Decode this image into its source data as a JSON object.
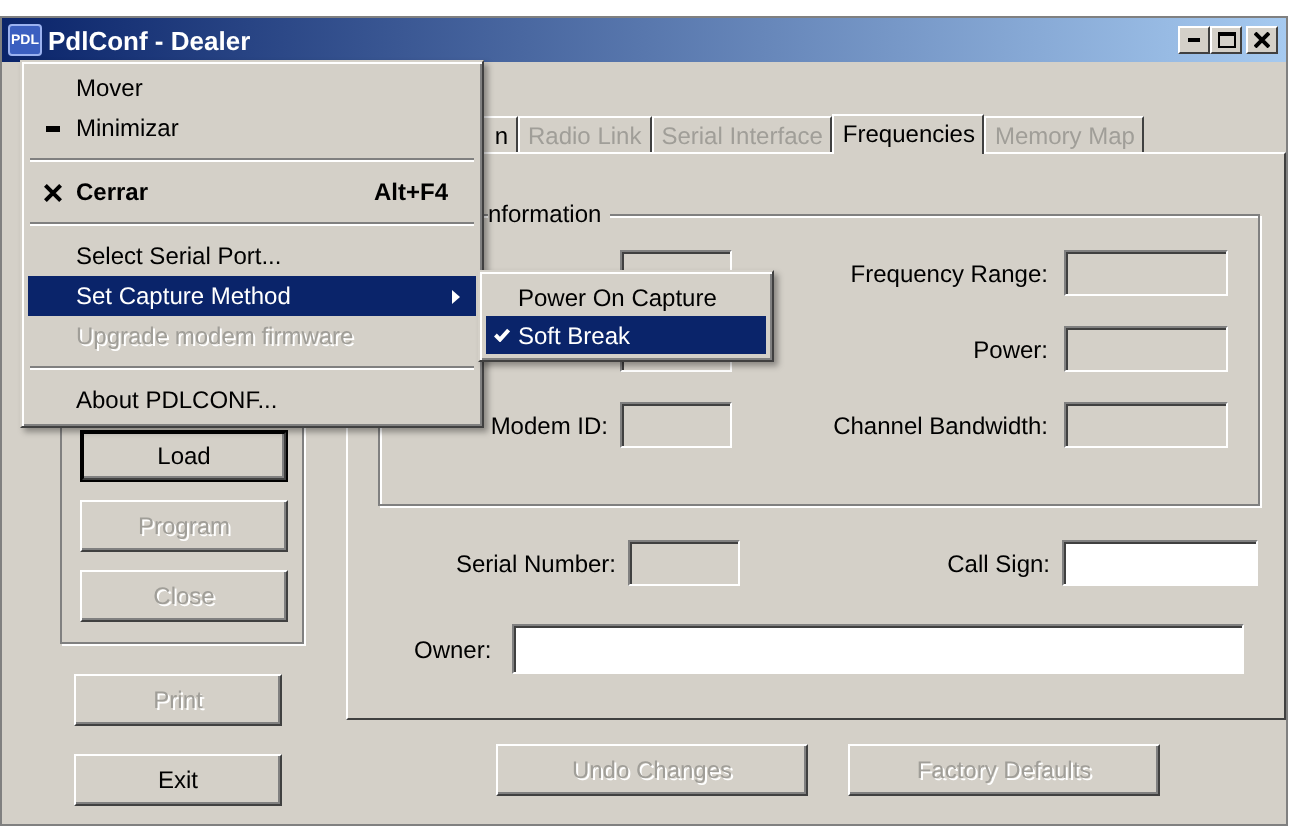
{
  "window": {
    "icon_text": "PDL",
    "title": "PdlConf - Dealer"
  },
  "left_group": {
    "buttons": [
      {
        "label": "Load",
        "disabled": false,
        "default": true
      },
      {
        "label": "Program",
        "disabled": true,
        "default": false
      },
      {
        "label": "Close",
        "disabled": true,
        "default": false
      }
    ]
  },
  "left_buttons": [
    {
      "label": "Print",
      "disabled": true
    },
    {
      "label": "Exit",
      "disabled": false
    }
  ],
  "tabs": [
    {
      "label": "n",
      "disabled": false,
      "selected": false
    },
    {
      "label": "Radio Link",
      "disabled": true,
      "selected": false
    },
    {
      "label": "Serial Interface",
      "disabled": true,
      "selected": false
    },
    {
      "label": "Frequencies",
      "disabled": false,
      "selected": true
    },
    {
      "label": "Memory Map",
      "disabled": true,
      "selected": false
    }
  ],
  "group": {
    "title": "nformation",
    "left_fields": [
      {
        "editable": false
      },
      {
        "editable": false
      },
      {
        "label": "Modem ID:",
        "editable": false
      }
    ],
    "right_fields": [
      {
        "label": "Frequency Range:",
        "editable": false
      },
      {
        "label": "Power:",
        "editable": false
      },
      {
        "label": "Channel Bandwidth:",
        "editable": false
      }
    ]
  },
  "serial_number": {
    "label": "Serial Number:",
    "editable": false
  },
  "call_sign": {
    "label": "Call Sign:",
    "editable": true
  },
  "owner": {
    "label": "Owner:",
    "editable": true
  },
  "bottom_buttons": [
    {
      "label": "Undo Changes",
      "disabled": true
    },
    {
      "label": "Factory Defaults",
      "disabled": true
    }
  ],
  "system_menu": [
    {
      "kind": "item",
      "label": "Mover",
      "bold": false,
      "disabled": false,
      "selected": false
    },
    {
      "kind": "minimize",
      "label": "Minimizar",
      "bold": false,
      "disabled": false,
      "selected": false
    },
    {
      "kind": "separator"
    },
    {
      "kind": "close",
      "label": "Cerrar",
      "shortcut": "Alt+F4",
      "bold": true,
      "disabled": false,
      "selected": false
    },
    {
      "kind": "separator"
    },
    {
      "kind": "item",
      "label": "Select Serial Port...",
      "bold": false,
      "disabled": false,
      "selected": false
    },
    {
      "kind": "submenu",
      "label": "Set Capture Method",
      "bold": false,
      "disabled": false,
      "selected": true
    },
    {
      "kind": "item",
      "label": "Upgrade modem firmware",
      "bold": false,
      "disabled": true,
      "selected": false
    },
    {
      "kind": "separator"
    },
    {
      "kind": "item",
      "label": "About PDLCONF...",
      "bold": false,
      "disabled": false,
      "selected": false
    }
  ],
  "submenu": [
    {
      "label": "Power On Capture",
      "checked": false,
      "selected": false
    },
    {
      "label": "Soft Break",
      "checked": true,
      "selected": true
    }
  ]
}
